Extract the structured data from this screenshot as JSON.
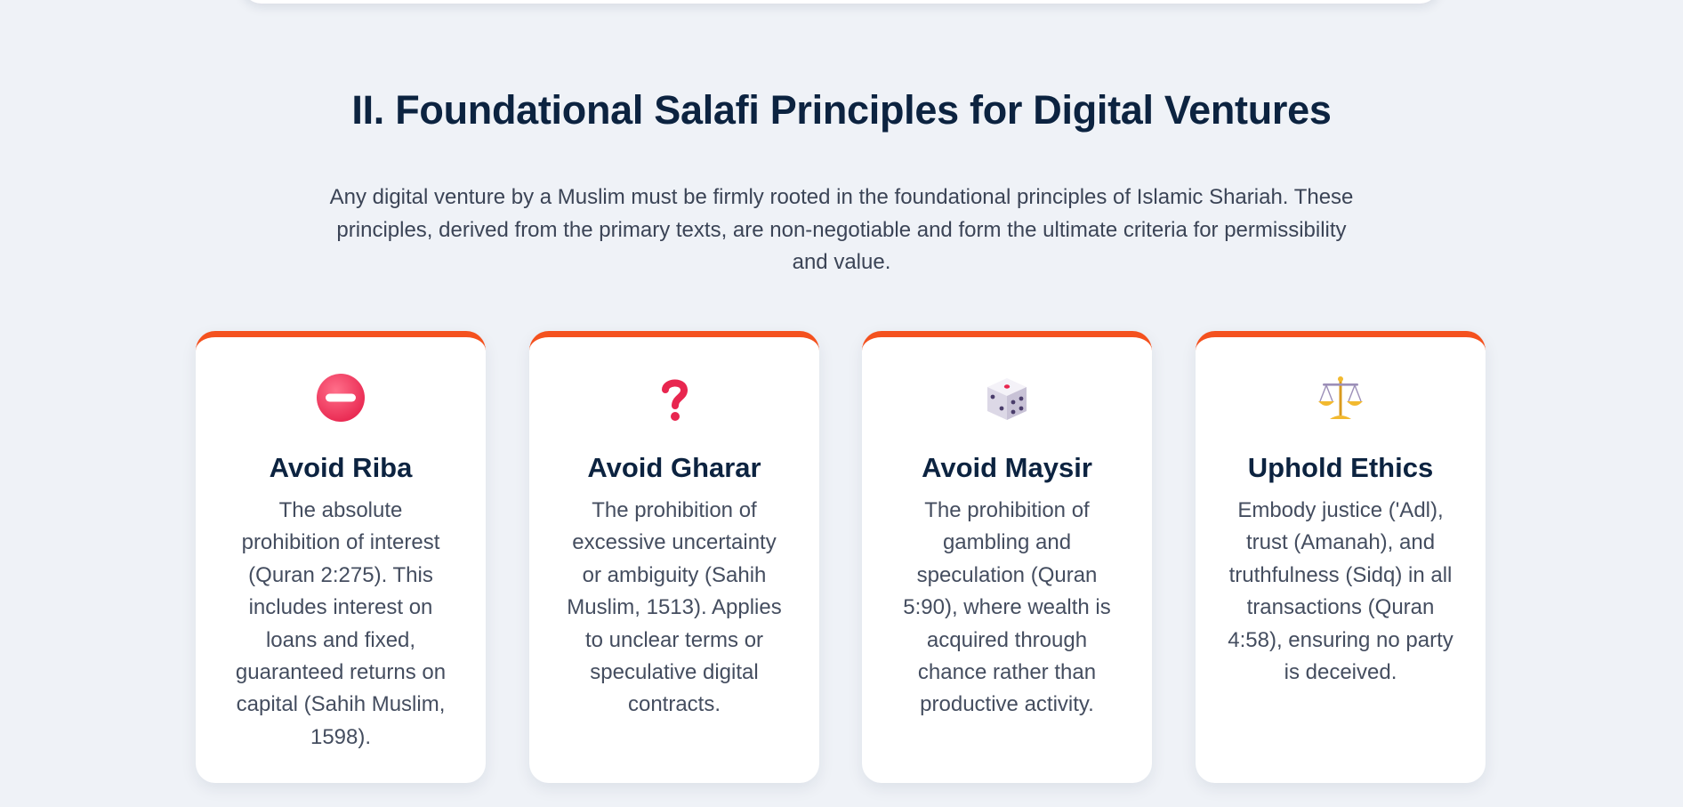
{
  "section": {
    "title": "II. Foundational Salafi Principles for Digital Ventures",
    "intro": "Any digital venture by a Muslim must be firmly rooted in the foundational principles of Islamic Shariah. These principles, derived from the primary texts, are non-negotiable and form the ultimate criteria for permissibility and value."
  },
  "colors": {
    "accent": "#f4511e",
    "heading": "#0c2340",
    "body_text": "#444d5f",
    "background": "#eff2f7",
    "card": "#ffffff"
  },
  "cards": [
    {
      "icon": "no-entry-icon",
      "title": "Avoid Riba",
      "text": "The absolute prohibition of interest (Quran 2:275). This includes interest on loans and fixed, guaranteed returns on capital (Sahih Muslim, 1598)."
    },
    {
      "icon": "question-mark-icon",
      "title": "Avoid Gharar",
      "text": "The prohibition of excessive uncertainty or ambiguity (Sahih Muslim, 1513). Applies to unclear terms or speculative digital contracts."
    },
    {
      "icon": "dice-icon",
      "title": "Avoid Maysir",
      "text": "The prohibition of gambling and speculation (Quran 5:90), where wealth is acquired through chance rather than productive activity."
    },
    {
      "icon": "balance-scale-icon",
      "title": "Uphold Ethics",
      "text": "Embody justice ('Adl), trust (Amanah), and truthfulness (Sidq) in all transactions (Quran 4:58), ensuring no party is deceived."
    }
  ]
}
